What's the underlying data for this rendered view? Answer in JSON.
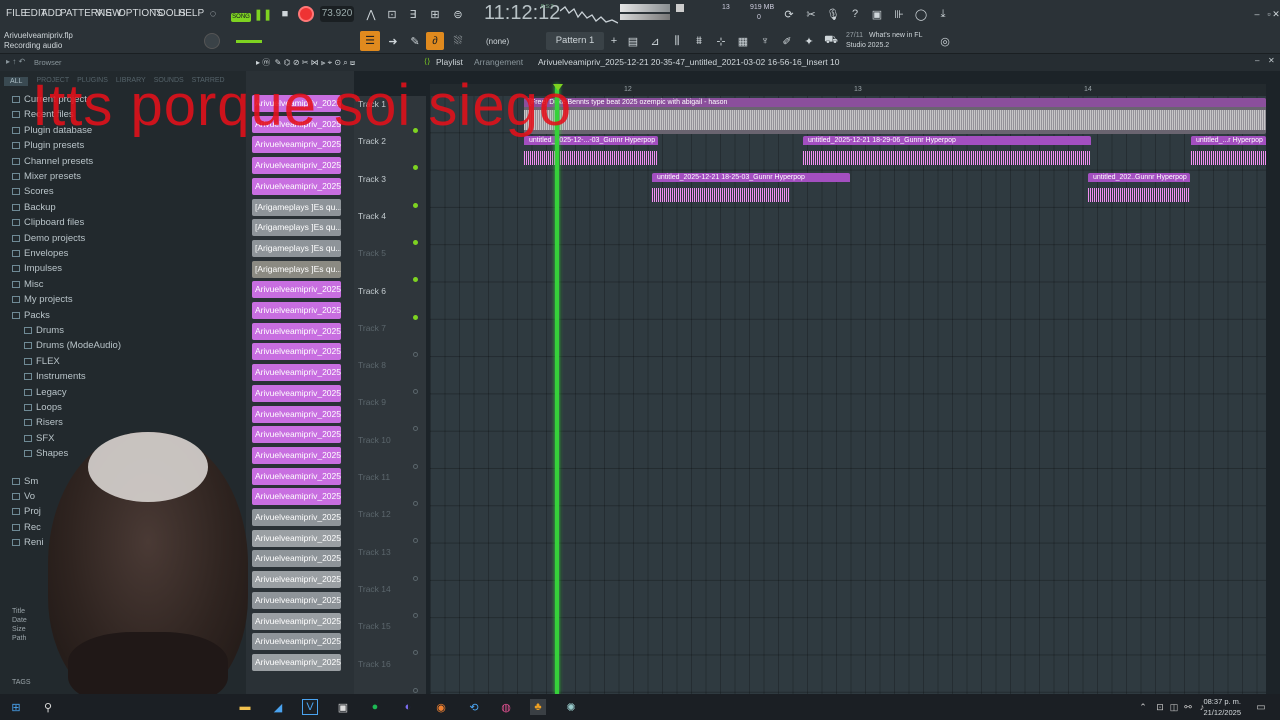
{
  "menu": [
    "FILE",
    "EDIT",
    "ADD",
    "PATTERNS",
    "VIEW",
    "OPTIONS",
    "TOOLS",
    "HELP"
  ],
  "transport": {
    "mode": "SONG",
    "tempo": "73.920",
    "clock": "11:12:12",
    "clock_sub": "B:S:T",
    "cpu": "13",
    "mem": "919 MB",
    "poly": "0"
  },
  "project": {
    "file": "Arivuelveamipriv.flp",
    "status": "Recording audio"
  },
  "toolbar2": {
    "snap": "(none)",
    "pattern": "Pattern 1",
    "news_date": "27/11",
    "news_text": "What's new in FL",
    "news_sub": "Studio 2025.2"
  },
  "browser": {
    "title": "Browser",
    "tabs": [
      "ALL",
      "PROJECT",
      "PLUGINS",
      "LIBRARY",
      "SOUNDS",
      "STARRED"
    ],
    "items": [
      "Current project",
      "Recent files",
      "Plugin database",
      "Plugin presets",
      "Channel presets",
      "Mixer presets",
      "Scores",
      "Backup",
      "Clipboard files",
      "Demo projects",
      "Envelopes",
      "Impulses",
      "Misc",
      "My projects",
      "Packs"
    ],
    "pack_items": [
      "Drums",
      "Drums (ModeAudio)",
      "FLEX",
      "Instruments",
      "Legacy",
      "Loops",
      "Risers",
      "SFX",
      "Shapes"
    ],
    "bottom_items": [
      "Sm",
      "Vo",
      "Proj",
      "Rec",
      "Reni"
    ],
    "info_labels": [
      "Title",
      "Date",
      "Size",
      "Path"
    ],
    "tags": "TAGS"
  },
  "playlist": {
    "title": "Playlist",
    "view": "Arrangement",
    "breadcrumb": "Arivuelveamipriv_2025-12-21 20-35-47_untitled_2021-03-02 16-56-16_Insert 10",
    "ruler": [
      "12",
      "13",
      "14"
    ]
  },
  "channels": [
    "Arivuelveamipriv_2025-1...",
    "Arivuelveamipriv_2025-1...",
    "Arivuelveamipriv_2025-1...",
    "Arivuelveamipriv_2025-1...",
    "Arivuelveamipriv_2025-1...",
    "[Arigameplays ]Es qu...",
    "[Arigameplays ]Es qu...",
    "[Arigameplays ]Es qu...",
    "[Arigameplays ]Es qu...",
    "Arivuelveamipriv_2025-1...",
    "Arivuelveamipriv_2025-1...",
    "Arivuelveamipriv_2025-1...",
    "Arivuelveamipriv_2025-1...",
    "Arivuelveamipriv_2025-1...",
    "Arivuelveamipriv_2025-1...",
    "Arivuelveamipriv_2025-1...",
    "Arivuelveamipriv_2025-1...",
    "Arivuelveamipriv_2025-1...",
    "Arivuelveamipriv_2025-1...",
    "Arivuelveamipriv_2025-1...",
    "Arivuelveamipriv_2025-1...",
    "Arivuelveamipriv_2025-1...",
    "Arivuelveamipriv_2025-1...",
    "Arivuelveamipriv_2025-1...",
    "Arivuelveamipriv_2025-1...",
    "Arivuelveamipriv_2025-1...",
    "Arivuelveamipriv_2025-1...",
    "Arivuelveamipriv_2025-1..."
  ],
  "tracks": [
    "Track 1",
    "Track 2",
    "Track 3",
    "Track 4",
    "Track 5",
    "Track 6",
    "Track 7",
    "Track 8",
    "Track 9",
    "Track 10",
    "Track 11",
    "Track 12",
    "Track 13",
    "Track 14",
    "Track 15",
    "Track 16"
  ],
  "clips": {
    "t1": "[Free] Duke Bennts type beat 2025 ozempic with abigail - hason",
    "t2a": "untitled_2025-12-...-03_Gunnr Hyperpop",
    "t2b": "untitled_2025-12-21 18-29-06_Gunnr Hyperpop",
    "t2c": "untitled_...r Hyperpop",
    "t3a": "untitled_2025-12-21 18-25-03_Gunnr Hyperpop",
    "t3b": "untitled_202..Gunnr Hyperpop"
  },
  "overlay_text": "Itts porque soi siego",
  "clock_tray": {
    "time": "08:37 p. m.",
    "date": "21/12/2025"
  },
  "colors": {
    "clip_pink": "#c86ee0",
    "clip_gray": "#8e9499",
    "playhead": "#36d13a",
    "overlay_red": "#e5101a"
  }
}
